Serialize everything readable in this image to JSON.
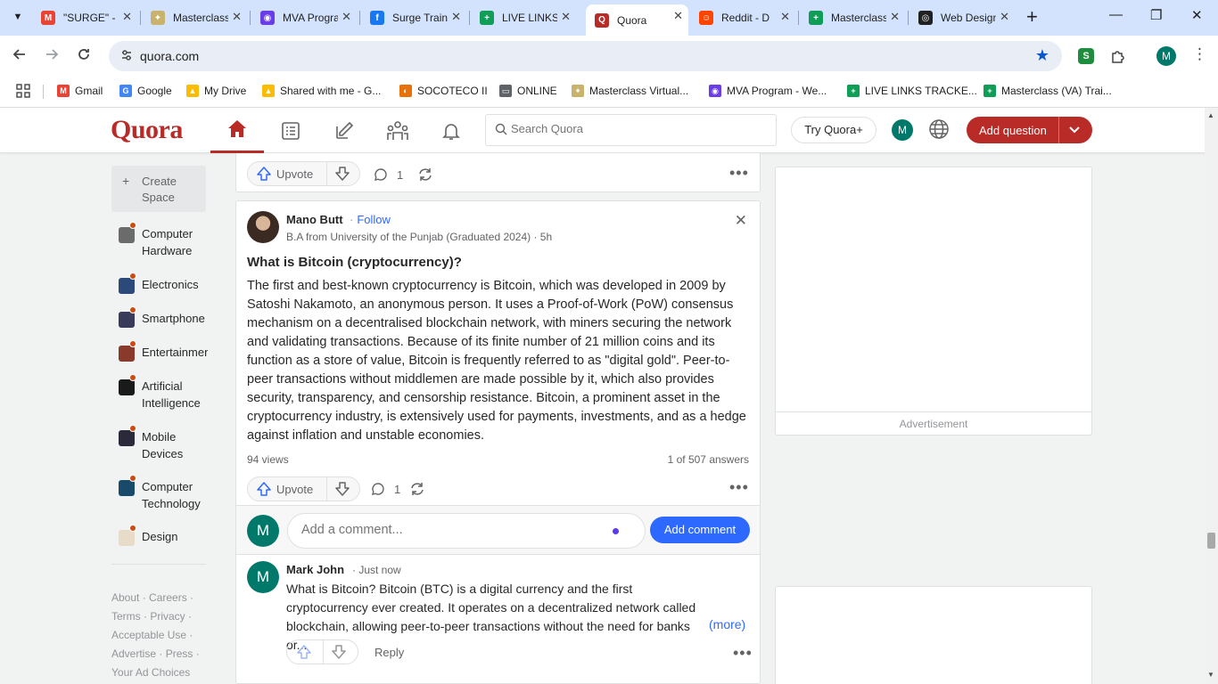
{
  "browser": {
    "tabs": [
      {
        "title": "\"SURGE\" -",
        "favicon": "gmail-icon",
        "color": "#ea4335",
        "glyph": "M"
      },
      {
        "title": "Masterclass",
        "favicon": "masterclass-icon",
        "color": "#c9b26b",
        "glyph": "✦"
      },
      {
        "title": "MVA Program",
        "favicon": "mva-icon",
        "color": "#6a3de8",
        "glyph": "◉"
      },
      {
        "title": "Surge Training",
        "favicon": "facebook-icon",
        "color": "#1877f2",
        "glyph": "f"
      },
      {
        "title": "LIVE LINKS",
        "favicon": "sheets-icon",
        "color": "#0f9d58",
        "glyph": "+"
      },
      {
        "title": "Quora",
        "favicon": "quora-icon",
        "color": "#b92b27",
        "glyph": "Q",
        "active": true
      },
      {
        "title": "Reddit - D",
        "favicon": "reddit-icon",
        "color": "#ff4500",
        "glyph": "☺"
      },
      {
        "title": "Masterclass",
        "favicon": "sheets-icon",
        "color": "#0f9d58",
        "glyph": "+"
      },
      {
        "title": "Web Design",
        "favicon": "openai-icon",
        "color": "#202123",
        "glyph": "◎"
      }
    ],
    "url": "quora.com",
    "profile_initial": "M",
    "bookmarks": [
      {
        "label": "Gmail",
        "icon": "gmail-icon",
        "color": "#ea4335",
        "glyph": "M"
      },
      {
        "label": "Google",
        "icon": "google-icon",
        "color": "#4285f4",
        "glyph": "G"
      },
      {
        "label": "My Drive",
        "icon": "drive-icon",
        "color": "#fbbc04",
        "glyph": "▲"
      },
      {
        "label": "Shared with me - G...",
        "icon": "drive-icon",
        "color": "#fbbc04",
        "glyph": "▲"
      },
      {
        "label": "SOCOTECO II",
        "icon": "socoteco-icon",
        "color": "#e8710a",
        "glyph": "◐"
      },
      {
        "label": "ONLINE",
        "icon": "folder-icon",
        "color": "#5f6368",
        "glyph": "▭"
      },
      {
        "label": "Masterclass Virtual...",
        "icon": "masterclass-icon",
        "color": "#c9b26b",
        "glyph": "✦"
      },
      {
        "label": "MVA Program - We...",
        "icon": "mva-icon",
        "color": "#6a3de8",
        "glyph": "◉"
      },
      {
        "label": "LIVE LINKS TRACKE...",
        "icon": "sheets-icon",
        "color": "#0f9d58",
        "glyph": "+"
      },
      {
        "label": "Masterclass (VA) Trai...",
        "icon": "sheets-icon",
        "color": "#0f9d58",
        "glyph": "+"
      }
    ]
  },
  "quora": {
    "logo": "Quora",
    "brand_color": "#b92b27",
    "search_placeholder": "Search Quora",
    "try_plus": "Try Quora+",
    "user_initial": "M",
    "add_question": "Add question"
  },
  "sidebar": {
    "create_space": "Create Space",
    "spaces": [
      {
        "label": "Computer Hardware",
        "color": "#6b6b6b"
      },
      {
        "label": "Electronics",
        "color": "#2b4a7a"
      },
      {
        "label": "Smartphone",
        "color": "#3a3a5a"
      },
      {
        "label": "Entertainment",
        "color": "#8a3a2a"
      },
      {
        "label": "Artificial Intelligence",
        "color": "#1a1a1a"
      },
      {
        "label": "Mobile Devices",
        "color": "#2a2a3a"
      },
      {
        "label": "Computer Technology",
        "color": "#1a4a6a"
      },
      {
        "label": "Design",
        "color": "#e8dcc8"
      }
    ],
    "footer": {
      "about": "About",
      "careers": "Careers",
      "terms": "Terms",
      "privacy": "Privacy",
      "acceptable_use": "Acceptable Use",
      "advertise": "Advertise",
      "press": "Press",
      "ad_choices": "Your Ad Choices"
    }
  },
  "feed": {
    "prev": {
      "upvote": "Upvote",
      "comments": "1"
    },
    "post": {
      "author": "Mano Butt",
      "follow": "Follow",
      "credential": "B.A from University of the Punjab (Graduated 2024) · 5h",
      "question": "What is Bitcoin (cryptocurrency)?",
      "answer": "The first and best-known cryptocurrency is Bitcoin, which was developed in 2009 by Satoshi Nakamoto, an anonymous person. It uses a Proof-of-Work (PoW) consensus mechanism on a decentralised blockchain network, with miners securing the network and validating transactions. Because of its finite number of 21 million coins and its function as a store of value, Bitcoin is frequently referred to as \"digital gold\". Peer-to-peer transactions without middlemen are made possible by it, which also provides security, transparency, and censorship resistance. Bitcoin, a prominent asset in the cryptocurrency industry, is extensively used for payments, investments, and as a hedge against inflation and unstable economies.",
      "views": "94 views",
      "answer_index": "1 of 507 answers",
      "upvote": "Upvote",
      "comments": "1"
    },
    "comment_box": {
      "placeholder": "Add a comment...",
      "button": "Add comment",
      "initial": "M"
    },
    "comment": {
      "initial": "M",
      "author": "Mark John",
      "time": "· Just now",
      "text": "What is Bitcoin? Bitcoin (BTC) is a digital currency and the first cryptocurrency ever created. It operates on a decentralized network called blockchain, allowing peer-to-peer transactions without the need for banks or...",
      "more": "(more)",
      "reply": "Reply"
    }
  },
  "ads": {
    "label": "Advertisement"
  }
}
